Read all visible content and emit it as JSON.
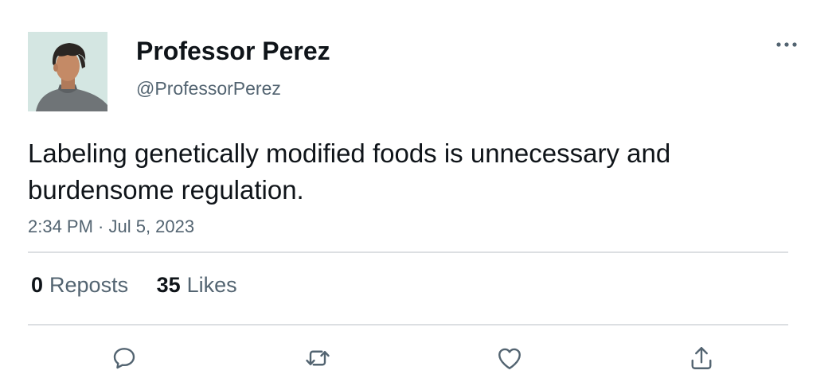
{
  "author": {
    "display_name": "Professor Perez",
    "handle": "@ProfessorPerez"
  },
  "tweet": {
    "text": "Labeling genetically modified foods is unnecessary and burdensome regulation.",
    "timestamp": "2:34 PM · Jul 5, 2023"
  },
  "stats": {
    "reposts_count": "0",
    "reposts_label": "Reposts",
    "likes_count": "35",
    "likes_label": "Likes"
  },
  "icons": {
    "more": "more-horizontal-icon",
    "reply": "reply-icon",
    "repost": "repost-icon",
    "like": "heart-icon",
    "share": "share-icon"
  },
  "colors": {
    "text_primary": "#0f1419",
    "text_secondary": "#536471",
    "divider": "#dcdfe2",
    "icon": "#536471",
    "avatar_background": "#d4e6e2"
  }
}
